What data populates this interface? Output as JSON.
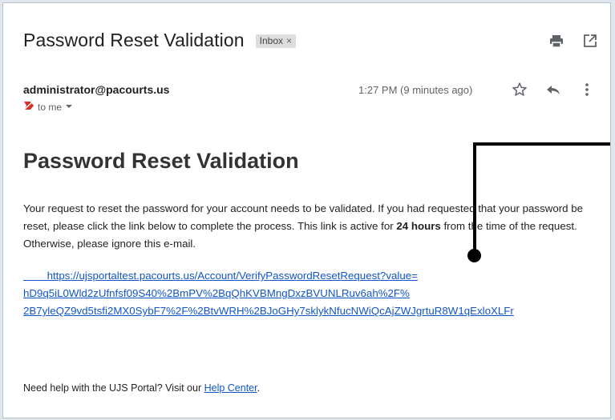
{
  "email": {
    "subject": "Password Reset Validation",
    "label": "Inbox",
    "label_close": "×",
    "sender": "administrator@pacourts.us",
    "recipient": "to me",
    "time": "1:27 PM (9 minutes ago)"
  },
  "content": {
    "heading": "Password Reset Validation",
    "para_1": "Your request to reset the password for your account needs to be validated. If you had requested that your password be reset, please click the link below to complete the process. This link is active for ",
    "para_bold": "24 hours",
    "para_2": " from the time of the request. Otherwise, please ignore this e-mail.",
    "link_line_1": "https://ujsportaltest.pacourts.us/Account/VerifyPasswordResetRequest?value=",
    "link_line_2": "hD9q5iL0Wld2zUfnfsf09S40%2BmPV%2BqQhKVBMngDxzBVUNLRuv6ah%2F%",
    "link_line_3": "2B7yleQZ9vd5tsfi2MX0SybF7%2F%2BtvWRH%2BJoGHy7sklykNfucNWiQcAjZWJgrtuR8W1qExloXLFr",
    "help_prefix": "Need help with the UJS Portal? Visit our ",
    "help_link": "Help Center",
    "help_suffix": "."
  },
  "icons": [
    "print-icon",
    "open-in-new-window-icon",
    "star-icon",
    "reply-icon",
    "more-vertical-icon",
    "importance-marker-icon",
    "caret-down-icon"
  ],
  "colors": {
    "link": "#1155cc",
    "importance": "#d93025",
    "callout": "#000000"
  }
}
